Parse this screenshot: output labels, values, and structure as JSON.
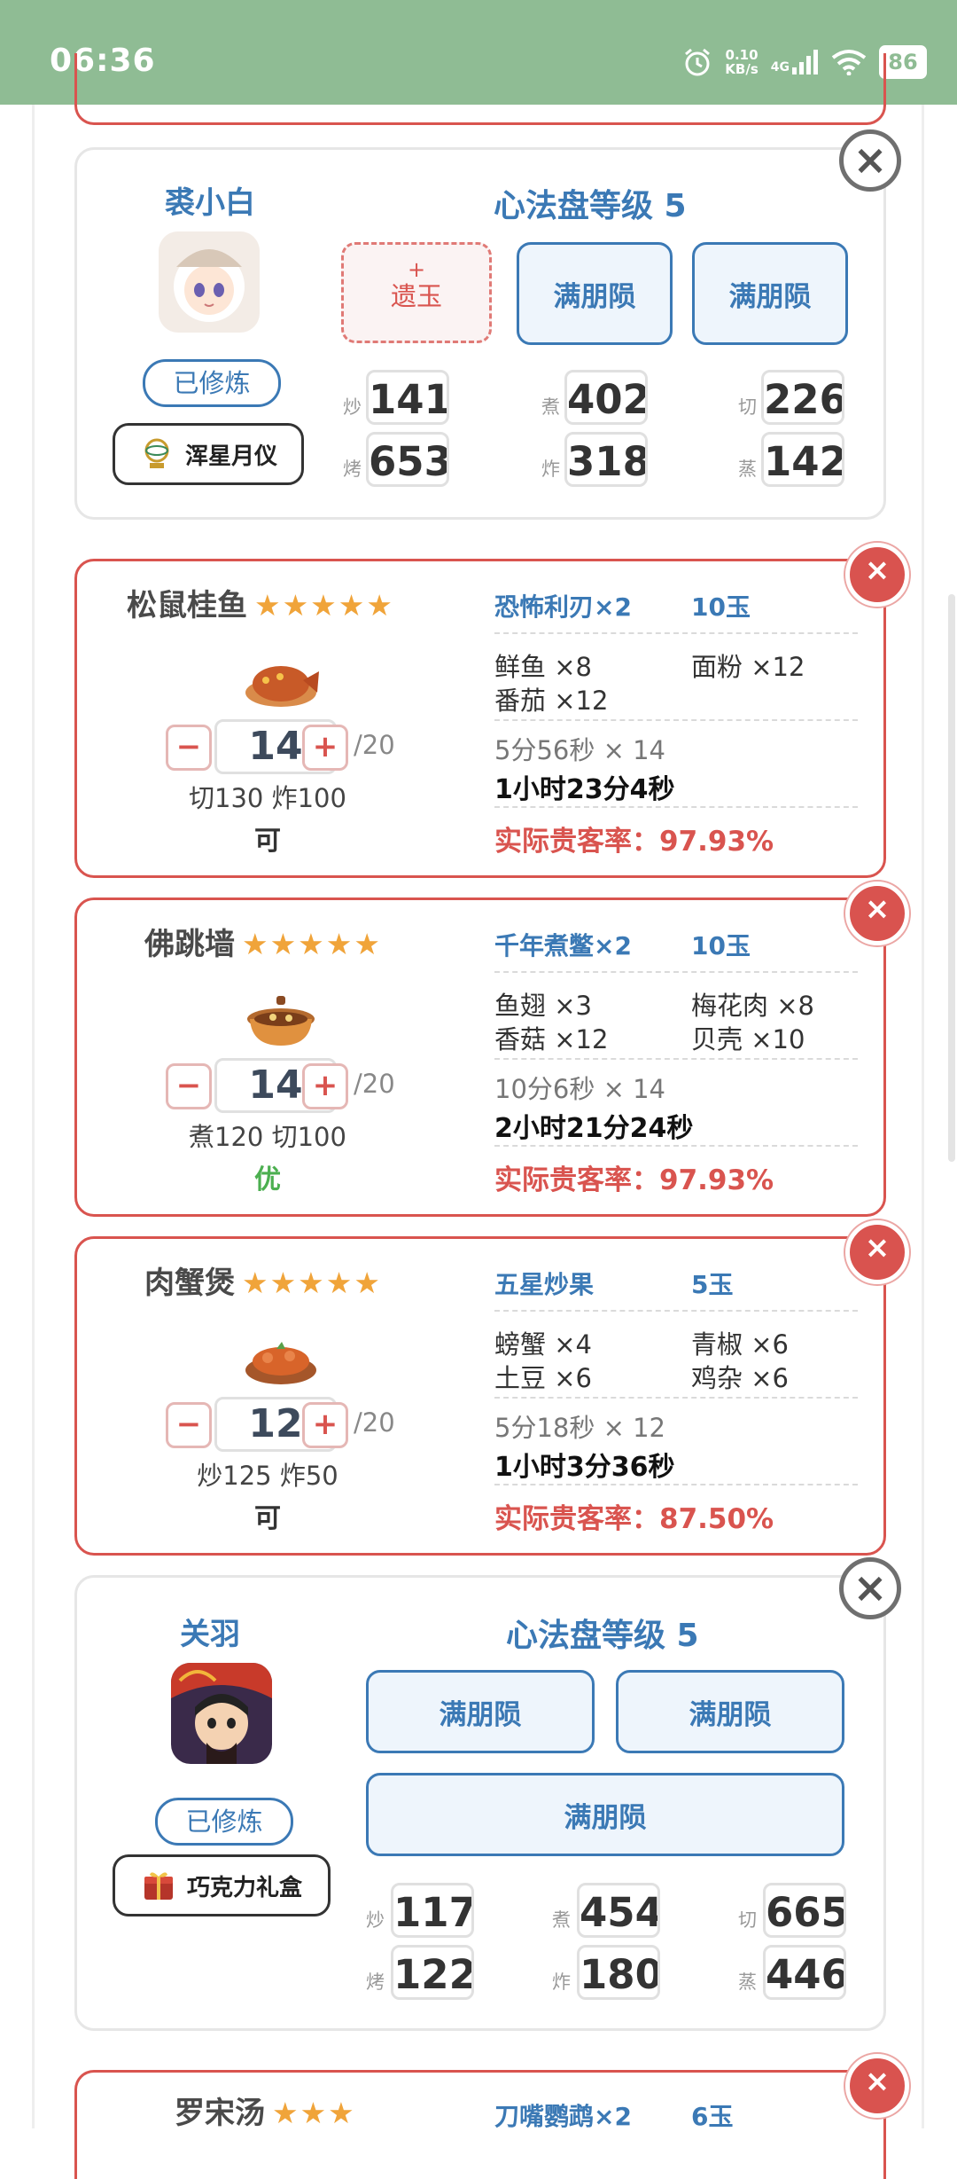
{
  "status": {
    "time": "06:36",
    "net_speed": "0.10",
    "net_unit": "KB/s",
    "network": "4G",
    "battery": "86"
  },
  "chef1": {
    "name": "裘小白",
    "level_text": "心法盘等级 5",
    "trained": "已修炼",
    "gift": "浑星月仪",
    "slots": [
      {
        "plus": "+",
        "label": "遗玉"
      },
      {
        "label": "满朋陨"
      },
      {
        "label": "满朋陨"
      }
    ],
    "stats": [
      {
        "label": "炒",
        "value": "141"
      },
      {
        "label": "煮",
        "value": "402"
      },
      {
        "label": "切",
        "value": "226"
      },
      {
        "label": "烤",
        "value": "653"
      },
      {
        "label": "炸",
        "value": "318"
      },
      {
        "label": "蒸",
        "value": "142"
      }
    ]
  },
  "recipes": [
    {
      "name": "松鼠桂鱼",
      "stars": "★★★★★",
      "qty": "14",
      "max": "/20",
      "req": "切130 炸100",
      "rating": "可",
      "rating_color": "#222",
      "guest": "恐怖利刃×2",
      "jade": "10玉",
      "ingredients": [
        "鲜鱼 ×8",
        "面粉 ×12",
        "番茄 ×12"
      ],
      "time_each": "5分56秒 × 14",
      "time_total": "1小时23分4秒",
      "rate": "实际贵客率：97.93%"
    },
    {
      "name": "佛跳墙",
      "stars": "★★★★★",
      "qty": "14",
      "max": "/20",
      "req": "煮120 切100",
      "rating": "优",
      "rating_color": "#4caf50",
      "guest": "千年煮鳖×2",
      "jade": "10玉",
      "ingredients": [
        "鱼翅 ×3",
        "梅花肉 ×8",
        "香菇 ×12",
        "贝壳 ×10"
      ],
      "time_each": "10分6秒 × 14",
      "time_total": "2小时21分24秒",
      "rate": "实际贵客率：97.93%"
    },
    {
      "name": "肉蟹煲",
      "stars": "★★★★★",
      "qty": "12",
      "max": "/20",
      "req": "炒125 炸50",
      "rating": "可",
      "rating_color": "#222",
      "guest": "五星炒果",
      "jade": "5玉",
      "ingredients": [
        "螃蟹 ×4",
        "青椒 ×6",
        "土豆 ×6",
        "鸡杂 ×6"
      ],
      "time_each": "5分18秒 × 12",
      "time_total": "1小时3分36秒",
      "rate": "实际贵客率：87.50%"
    }
  ],
  "chef2": {
    "name": "关羽",
    "level_text": "心法盘等级 5",
    "trained": "已修炼",
    "gift": "巧克力礼盒",
    "slots": [
      {
        "label": "满朋陨"
      },
      {
        "label": "满朋陨"
      },
      {
        "label": "满朋陨"
      }
    ],
    "stats": [
      {
        "label": "炒",
        "value": "117"
      },
      {
        "label": "煮",
        "value": "454"
      },
      {
        "label": "切",
        "value": "665"
      },
      {
        "label": "烤",
        "value": "122"
      },
      {
        "label": "炸",
        "value": "180"
      },
      {
        "label": "蒸",
        "value": "446"
      }
    ]
  },
  "recipe_partial": {
    "name": "罗宋汤",
    "stars": "★★★",
    "guest": "刀嘴鹦鹉×2",
    "jade": "6玉"
  },
  "icons": {
    "close": "×",
    "minus": "−",
    "plus": "+"
  }
}
